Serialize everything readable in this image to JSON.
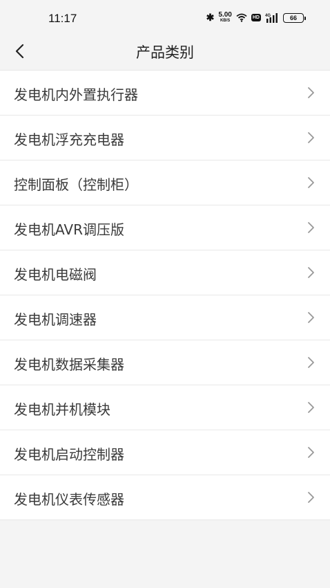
{
  "status_bar": {
    "time": "11:17",
    "speed_value": "5.00",
    "speed_unit": "KB/S",
    "hd_label": "HD",
    "network_label": "4G",
    "battery_level": "66",
    "icons": [
      "bluetooth-icon",
      "wifi-icon",
      "hd-icon",
      "signal-icon",
      "battery-icon"
    ]
  },
  "header": {
    "title": "产品类别",
    "back_icon": "back-chevron-icon"
  },
  "categories": [
    {
      "label": "发电机内外置执行器"
    },
    {
      "label": "发电机浮充充电器"
    },
    {
      "label": "控制面板（控制柜）"
    },
    {
      "label": "发电机AVR调压版"
    },
    {
      "label": "发电机电磁阀"
    },
    {
      "label": "发电机调速器"
    },
    {
      "label": "发电机数据采集器"
    },
    {
      "label": "发电机并机模块"
    },
    {
      "label": "发电机启动控制器"
    },
    {
      "label": "发电机仪表传感器"
    }
  ],
  "colors": {
    "background": "#f4f4f4",
    "list_background": "#ffffff",
    "divider": "#e8e8e8",
    "text": "#3a3a3a",
    "chevron": "#999999"
  }
}
